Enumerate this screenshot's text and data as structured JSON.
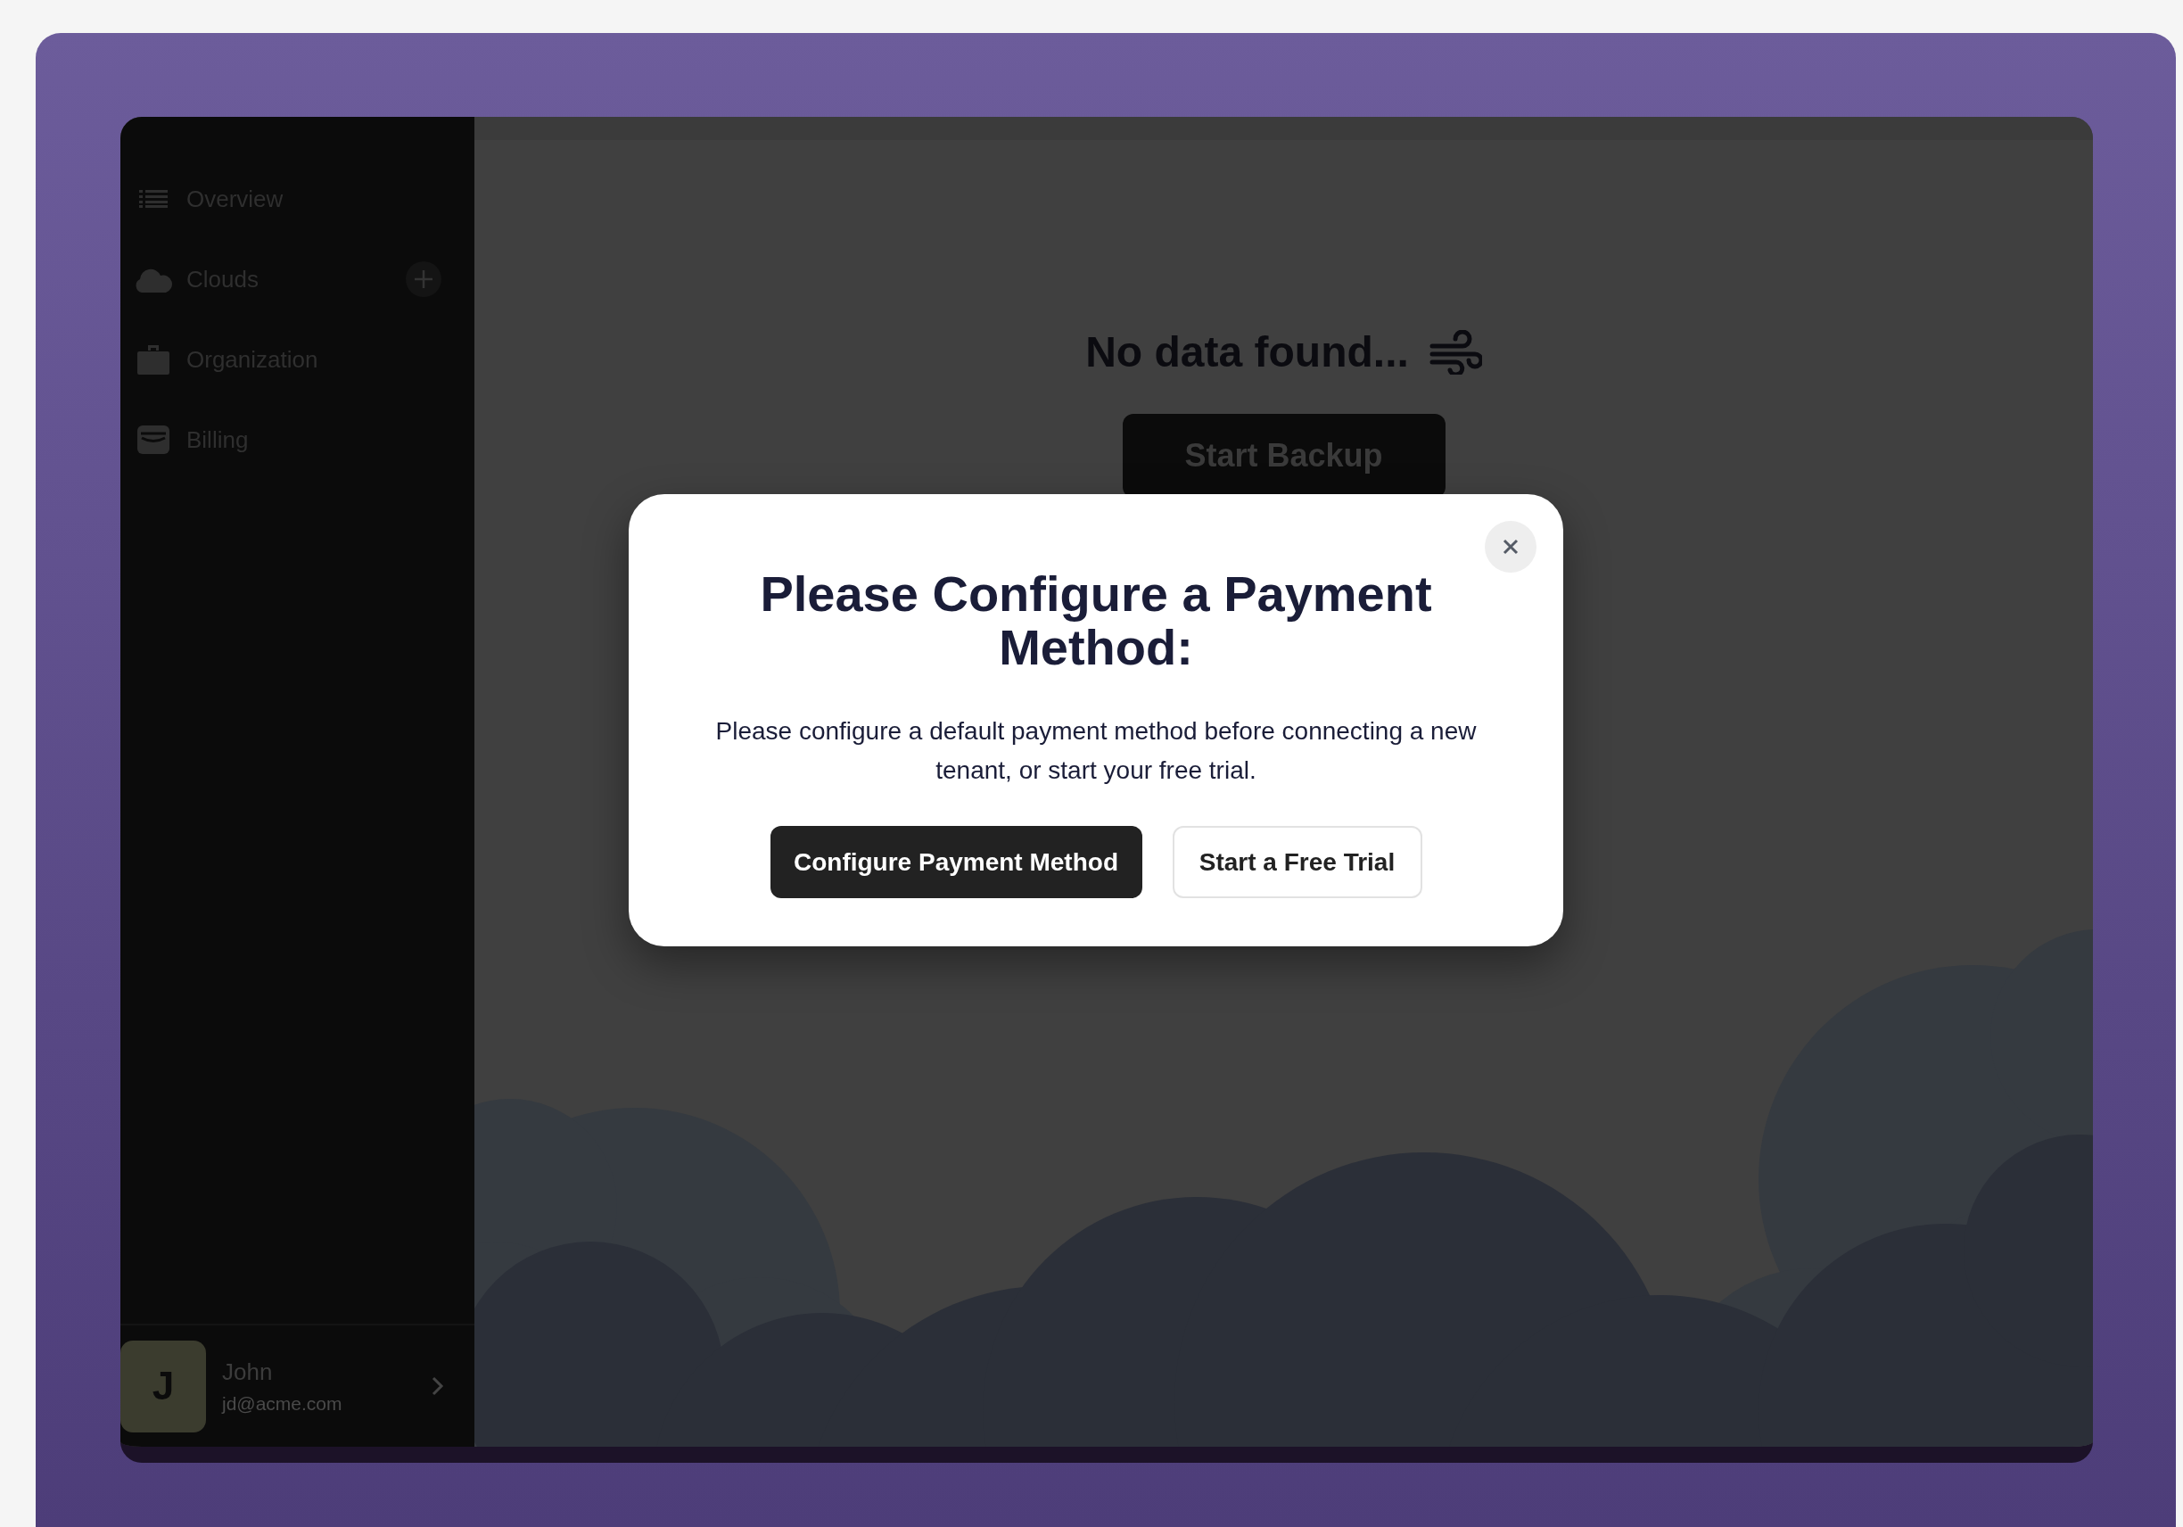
{
  "sidebar": {
    "items": [
      {
        "label": "Overview"
      },
      {
        "label": "Clouds"
      },
      {
        "label": "Organization"
      },
      {
        "label": "Billing"
      }
    ]
  },
  "user": {
    "initial": "J",
    "name": "John",
    "email": "jd@acme.com"
  },
  "main": {
    "empty_title": "No data found...",
    "button": "Start Backup"
  },
  "dialog": {
    "title": "Please Configure a Payment Method:",
    "message": "Please configure a default payment method before connecting a new tenant, or start your free trial.",
    "buttons": [
      {
        "label": "Configure Payment Method",
        "kind": "primary"
      },
      {
        "label": "Start a Free Trial",
        "kind": "secondary"
      }
    ]
  }
}
